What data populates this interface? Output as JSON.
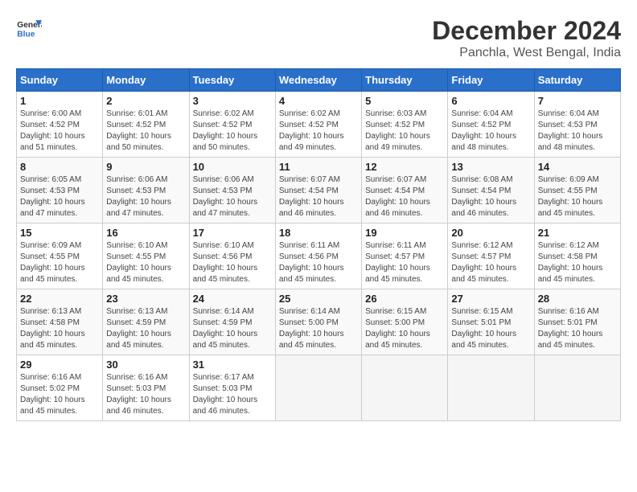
{
  "logo": {
    "line1": "General",
    "line2": "Blue"
  },
  "title": "December 2024",
  "subtitle": "Panchla, West Bengal, India",
  "weekdays": [
    "Sunday",
    "Monday",
    "Tuesday",
    "Wednesday",
    "Thursday",
    "Friday",
    "Saturday"
  ],
  "weeks": [
    [
      {
        "day": "1",
        "sunrise": "Sunrise: 6:00 AM",
        "sunset": "Sunset: 4:52 PM",
        "daylight": "Daylight: 10 hours and 51 minutes."
      },
      {
        "day": "2",
        "sunrise": "Sunrise: 6:01 AM",
        "sunset": "Sunset: 4:52 PM",
        "daylight": "Daylight: 10 hours and 50 minutes."
      },
      {
        "day": "3",
        "sunrise": "Sunrise: 6:02 AM",
        "sunset": "Sunset: 4:52 PM",
        "daylight": "Daylight: 10 hours and 50 minutes."
      },
      {
        "day": "4",
        "sunrise": "Sunrise: 6:02 AM",
        "sunset": "Sunset: 4:52 PM",
        "daylight": "Daylight: 10 hours and 49 minutes."
      },
      {
        "day": "5",
        "sunrise": "Sunrise: 6:03 AM",
        "sunset": "Sunset: 4:52 PM",
        "daylight": "Daylight: 10 hours and 49 minutes."
      },
      {
        "day": "6",
        "sunrise": "Sunrise: 6:04 AM",
        "sunset": "Sunset: 4:52 PM",
        "daylight": "Daylight: 10 hours and 48 minutes."
      },
      {
        "day": "7",
        "sunrise": "Sunrise: 6:04 AM",
        "sunset": "Sunset: 4:53 PM",
        "daylight": "Daylight: 10 hours and 48 minutes."
      }
    ],
    [
      {
        "day": "8",
        "sunrise": "Sunrise: 6:05 AM",
        "sunset": "Sunset: 4:53 PM",
        "daylight": "Daylight: 10 hours and 47 minutes."
      },
      {
        "day": "9",
        "sunrise": "Sunrise: 6:06 AM",
        "sunset": "Sunset: 4:53 PM",
        "daylight": "Daylight: 10 hours and 47 minutes."
      },
      {
        "day": "10",
        "sunrise": "Sunrise: 6:06 AM",
        "sunset": "Sunset: 4:53 PM",
        "daylight": "Daylight: 10 hours and 47 minutes."
      },
      {
        "day": "11",
        "sunrise": "Sunrise: 6:07 AM",
        "sunset": "Sunset: 4:54 PM",
        "daylight": "Daylight: 10 hours and 46 minutes."
      },
      {
        "day": "12",
        "sunrise": "Sunrise: 6:07 AM",
        "sunset": "Sunset: 4:54 PM",
        "daylight": "Daylight: 10 hours and 46 minutes."
      },
      {
        "day": "13",
        "sunrise": "Sunrise: 6:08 AM",
        "sunset": "Sunset: 4:54 PM",
        "daylight": "Daylight: 10 hours and 46 minutes."
      },
      {
        "day": "14",
        "sunrise": "Sunrise: 6:09 AM",
        "sunset": "Sunset: 4:55 PM",
        "daylight": "Daylight: 10 hours and 45 minutes."
      }
    ],
    [
      {
        "day": "15",
        "sunrise": "Sunrise: 6:09 AM",
        "sunset": "Sunset: 4:55 PM",
        "daylight": "Daylight: 10 hours and 45 minutes."
      },
      {
        "day": "16",
        "sunrise": "Sunrise: 6:10 AM",
        "sunset": "Sunset: 4:55 PM",
        "daylight": "Daylight: 10 hours and 45 minutes."
      },
      {
        "day": "17",
        "sunrise": "Sunrise: 6:10 AM",
        "sunset": "Sunset: 4:56 PM",
        "daylight": "Daylight: 10 hours and 45 minutes."
      },
      {
        "day": "18",
        "sunrise": "Sunrise: 6:11 AM",
        "sunset": "Sunset: 4:56 PM",
        "daylight": "Daylight: 10 hours and 45 minutes."
      },
      {
        "day": "19",
        "sunrise": "Sunrise: 6:11 AM",
        "sunset": "Sunset: 4:57 PM",
        "daylight": "Daylight: 10 hours and 45 minutes."
      },
      {
        "day": "20",
        "sunrise": "Sunrise: 6:12 AM",
        "sunset": "Sunset: 4:57 PM",
        "daylight": "Daylight: 10 hours and 45 minutes."
      },
      {
        "day": "21",
        "sunrise": "Sunrise: 6:12 AM",
        "sunset": "Sunset: 4:58 PM",
        "daylight": "Daylight: 10 hours and 45 minutes."
      }
    ],
    [
      {
        "day": "22",
        "sunrise": "Sunrise: 6:13 AM",
        "sunset": "Sunset: 4:58 PM",
        "daylight": "Daylight: 10 hours and 45 minutes."
      },
      {
        "day": "23",
        "sunrise": "Sunrise: 6:13 AM",
        "sunset": "Sunset: 4:59 PM",
        "daylight": "Daylight: 10 hours and 45 minutes."
      },
      {
        "day": "24",
        "sunrise": "Sunrise: 6:14 AM",
        "sunset": "Sunset: 4:59 PM",
        "daylight": "Daylight: 10 hours and 45 minutes."
      },
      {
        "day": "25",
        "sunrise": "Sunrise: 6:14 AM",
        "sunset": "Sunset: 5:00 PM",
        "daylight": "Daylight: 10 hours and 45 minutes."
      },
      {
        "day": "26",
        "sunrise": "Sunrise: 6:15 AM",
        "sunset": "Sunset: 5:00 PM",
        "daylight": "Daylight: 10 hours and 45 minutes."
      },
      {
        "day": "27",
        "sunrise": "Sunrise: 6:15 AM",
        "sunset": "Sunset: 5:01 PM",
        "daylight": "Daylight: 10 hours and 45 minutes."
      },
      {
        "day": "28",
        "sunrise": "Sunrise: 6:16 AM",
        "sunset": "Sunset: 5:01 PM",
        "daylight": "Daylight: 10 hours and 45 minutes."
      }
    ],
    [
      {
        "day": "29",
        "sunrise": "Sunrise: 6:16 AM",
        "sunset": "Sunset: 5:02 PM",
        "daylight": "Daylight: 10 hours and 45 minutes."
      },
      {
        "day": "30",
        "sunrise": "Sunrise: 6:16 AM",
        "sunset": "Sunset: 5:03 PM",
        "daylight": "Daylight: 10 hours and 46 minutes."
      },
      {
        "day": "31",
        "sunrise": "Sunrise: 6:17 AM",
        "sunset": "Sunset: 5:03 PM",
        "daylight": "Daylight: 10 hours and 46 minutes."
      },
      null,
      null,
      null,
      null
    ]
  ]
}
